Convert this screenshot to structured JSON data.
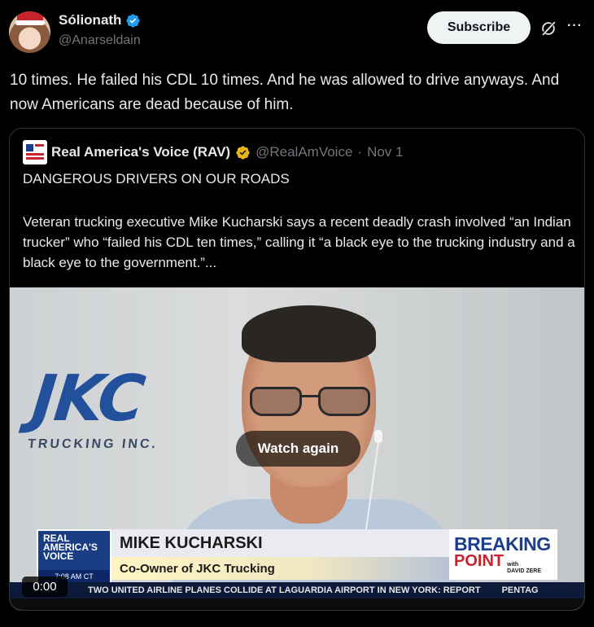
{
  "author": {
    "display_name": "Sólionath",
    "handle": "@Anarseldain"
  },
  "actions": {
    "subscribe_label": "Subscribe",
    "more_label": "···"
  },
  "tweet": {
    "text": "10 times. He failed his CDL 10 times. And he was allowed to drive anyways. And now Americans are dead because of him."
  },
  "quote": {
    "name": "Real America's Voice (RAV)",
    "handle": "@RealAmVoice",
    "separator": "·",
    "date": "Nov 1",
    "title": "DANGEROUS DRIVERS ON OUR ROADS",
    "body": "Veteran trucking executive Mike Kucharski says a recent deadly crash involved “an Indian trucker” who “failed his CDL ten times,” calling it “a black eye to the trucking industry and a black eye to the government.”...",
    "video": {
      "watch_again_label": "Watch again",
      "timecode": "0:00",
      "logo_text": "JKC",
      "logo_sub": "TRUCKING INC.",
      "lower_third": {
        "network_line1": "REAL",
        "network_line2": "AMERICA'S",
        "network_line3": "VOICE",
        "clock": "7:08 AM CT",
        "name": "MIKE KUCHARSKI",
        "title": "Co-Owner of JKC Trucking",
        "show_line1": "BREAKING",
        "show_line2": "POINT",
        "show_with": "with",
        "show_host": "DAVID ZERE"
      },
      "ticker": "TWO UNITED AIRLINE PLANES COLLIDE AT LAGUARDIA AIRPORT IN NEW YORK: REPORT",
      "ticker_next": "PENTAG"
    }
  },
  "colors": {
    "background": "#000000",
    "text_primary": "#e7e9ea",
    "text_secondary": "#71767b",
    "verified_blue": "#1d9bf0",
    "verified_gold": "#e2b719",
    "subscribe_bg": "#eff3f4"
  }
}
